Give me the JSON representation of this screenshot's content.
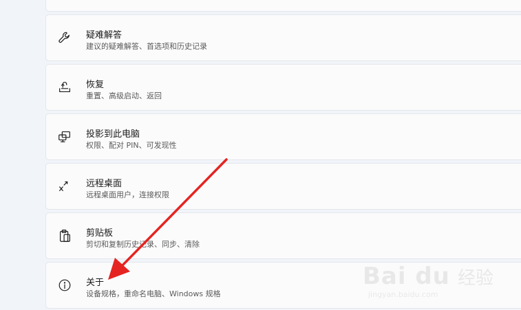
{
  "settings_list": {
    "items": [
      {
        "id": "troubleshoot",
        "icon": "wrench-icon",
        "title": "疑难解答",
        "subtitle": "建议的疑难解答、首选项和历史记录"
      },
      {
        "id": "recovery",
        "icon": "recovery-icon",
        "title": "恢复",
        "subtitle": "重置、高级启动、返回"
      },
      {
        "id": "projecting",
        "icon": "project-to-pc-icon",
        "title": "投影到此电脑",
        "subtitle": "权限、配对 PIN、可发现性"
      },
      {
        "id": "remote-desktop",
        "icon": "remote-desktop-icon",
        "title": "远程桌面",
        "subtitle": "远程桌面用户，连接权限"
      },
      {
        "id": "clipboard",
        "icon": "clipboard-icon",
        "title": "剪贴板",
        "subtitle": "剪切和复制历史记录、同步、清除"
      },
      {
        "id": "about",
        "icon": "info-icon",
        "title": "关于",
        "subtitle": "设备规格，重命名电脑、Windows 规格"
      }
    ]
  },
  "annotation": {
    "arrow_color": "#e52421",
    "target": "about"
  },
  "watermark": {
    "brand": "Bai du",
    "brand_suffix": "经验",
    "url": "jingyan.baidu.com"
  }
}
